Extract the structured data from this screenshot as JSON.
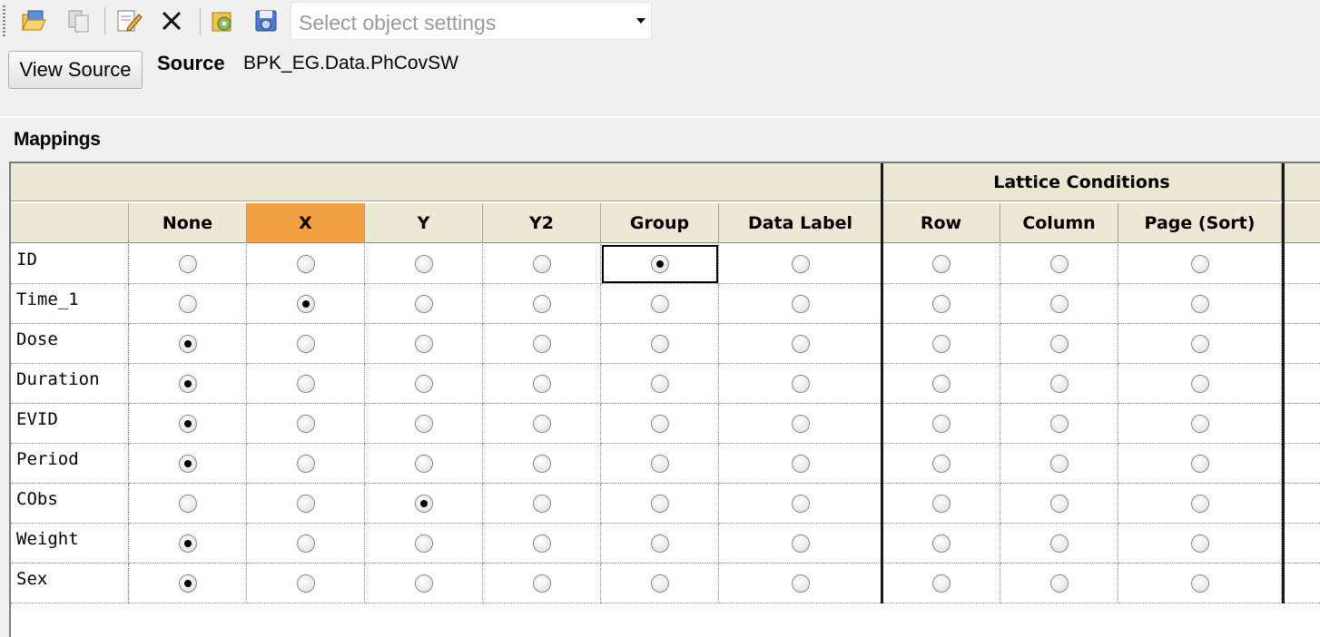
{
  "toolbar": {
    "buttons": [
      {
        "name": "open-icon"
      },
      {
        "name": "copy-icon"
      },
      {
        "name": "edit-settings-icon"
      },
      {
        "name": "delete-icon"
      },
      {
        "name": "load-settings-icon"
      },
      {
        "name": "save-settings-icon"
      }
    ],
    "settings_placeholder": "Select object settings"
  },
  "source": {
    "view_button_label": "View Source",
    "label": "Source",
    "value": "BPK_EG.Data.PhCovSW"
  },
  "mappings": {
    "title": "Mappings",
    "group_header": "Lattice Conditions",
    "columns": [
      "None",
      "X",
      "Y",
      "Y2",
      "Group",
      "Data Label",
      "Row",
      "Column",
      "Page (Sort)"
    ],
    "active_column": "X",
    "rows": [
      {
        "label": "ID",
        "selected": "Group"
      },
      {
        "label": "Time_1",
        "selected": "X"
      },
      {
        "label": "Dose",
        "selected": "None"
      },
      {
        "label": "Duration",
        "selected": "None"
      },
      {
        "label": "EVID",
        "selected": "None"
      },
      {
        "label": "Period",
        "selected": "None"
      },
      {
        "label": "CObs",
        "selected": "Y"
      },
      {
        "label": "Weight",
        "selected": "None"
      },
      {
        "label": "Sex",
        "selected": "None"
      }
    ]
  }
}
